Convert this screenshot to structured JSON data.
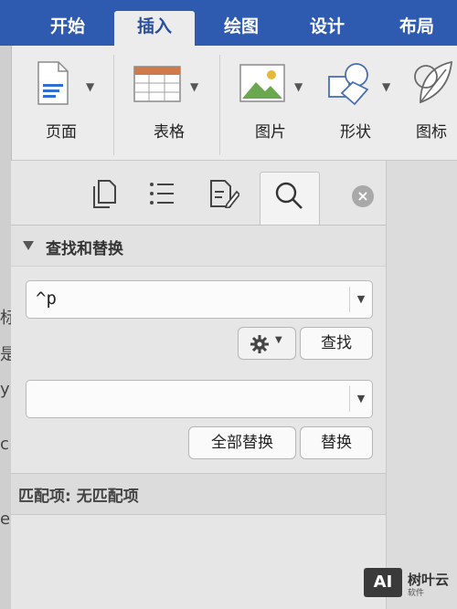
{
  "ribbon_tabs": {
    "home": "开始",
    "insert": "插入",
    "draw": "绘图",
    "design": "设计",
    "layout": "布局"
  },
  "ribbon": {
    "page_label": "页面",
    "table_label": "表格",
    "picture_label": "图片",
    "shapes_label": "形状",
    "icons_label": "图标"
  },
  "pane": {
    "section_title": "查找和替换",
    "find_value": "^p",
    "replace_value": "",
    "find_button": "查找",
    "replace_all_button": "全部替换",
    "replace_button": "替换",
    "match_status": "匹配项: 无匹配项"
  },
  "document_edge": [
    "标",
    "是",
    "y",
    "c",
    "e"
  ],
  "watermark": {
    "logo": "AI",
    "name": "树叶云",
    "sub": "软件"
  },
  "colors": {
    "ribbon_blue": "#2e5bb0",
    "pane_bg": "#e6e6e6"
  }
}
